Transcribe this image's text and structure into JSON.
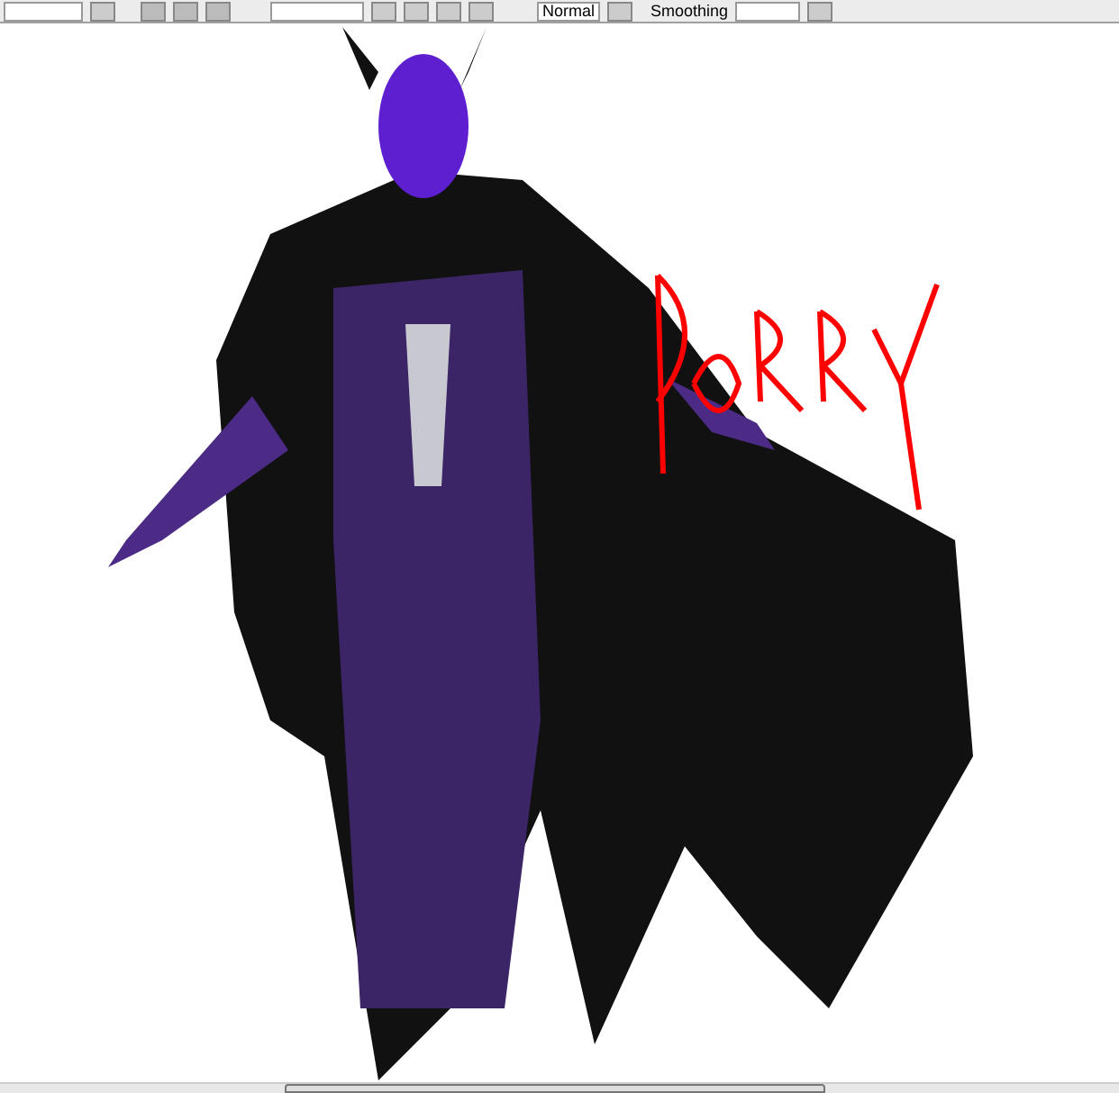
{
  "toolbar": {
    "blend_mode": "Normal",
    "smoothing_label": "Smoothing"
  }
}
